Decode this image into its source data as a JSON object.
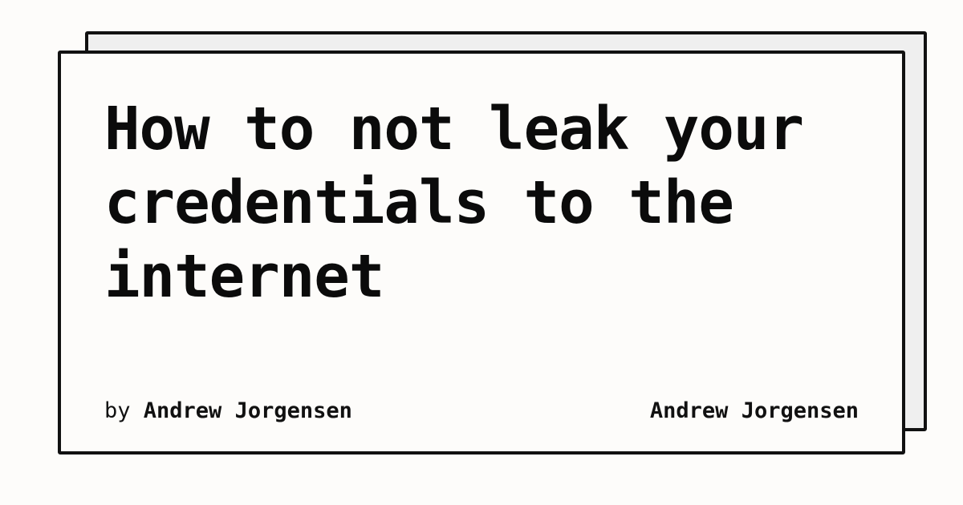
{
  "card": {
    "title": "How to not leak your credentials to the internet",
    "byline": {
      "prefix": "by",
      "author": "Andrew Jorgensen"
    },
    "site_name": "Andrew Jorgensen"
  },
  "colors": {
    "background": "#fdfcfa",
    "back_card": "#efefef",
    "border": "#111111",
    "text": "#0b0b0b"
  }
}
